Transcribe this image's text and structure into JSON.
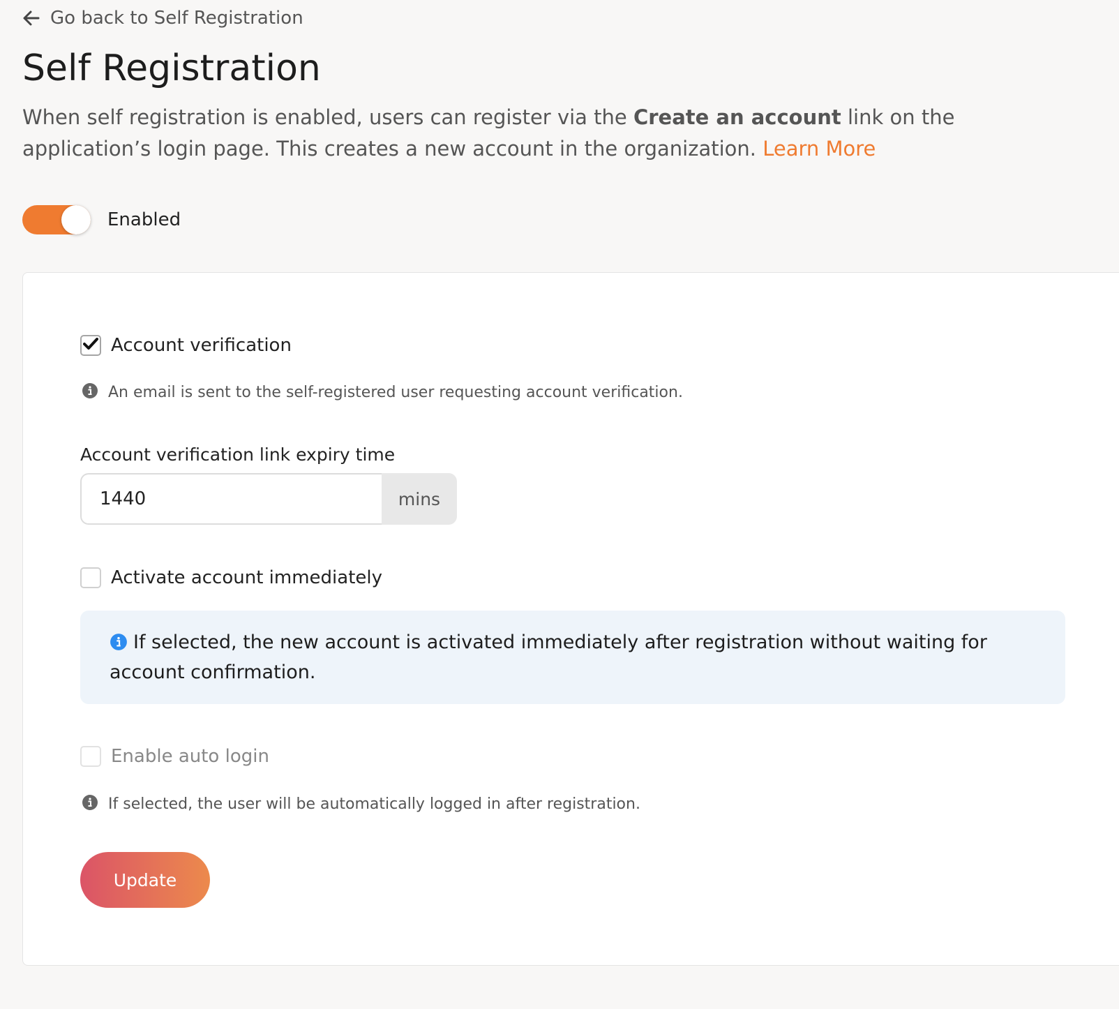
{
  "header": {
    "back_link_label": "Go back to Self Registration",
    "page_title": "Self Registration",
    "description_prefix": "When self registration is enabled, users can register via the ",
    "description_bold": "Create an account",
    "description_suffix": " link on the application’s login page. This creates a new account in the organization. ",
    "learn_more_label": "Learn More"
  },
  "toggle": {
    "label": "Enabled",
    "enabled": true
  },
  "settings": {
    "account_verification": {
      "label": "Account verification",
      "checked": true,
      "hint": "An email is sent to the self-registered user requesting account verification."
    },
    "expiry": {
      "label": "Account verification link expiry time",
      "value": "1440",
      "unit": "mins"
    },
    "activate_immediately": {
      "label": "Activate account immediately",
      "checked": false,
      "info": "If selected, the new account is activated immediately after registration without waiting for account confirmation."
    },
    "auto_login": {
      "label": "Enable auto login",
      "checked": false,
      "disabled": true,
      "hint": "If selected, the user will be automatically logged in after registration."
    },
    "update_label": "Update"
  },
  "colors": {
    "accent": "#ef7b30",
    "info_blue": "#2d8cf0",
    "info_box_bg": "#eef4fa",
    "update_gradient_start": "#db5467",
    "update_gradient_end": "#ec8a4c"
  }
}
